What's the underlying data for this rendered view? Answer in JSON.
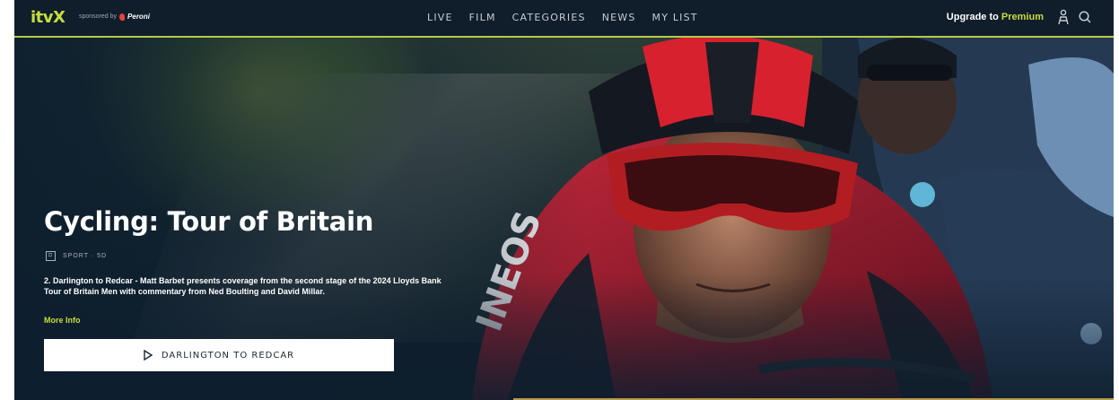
{
  "header": {
    "logo": "itvX",
    "sponsor_prefix": "sponsored by",
    "sponsor_brand": "Peroni",
    "nav": [
      "LIVE",
      "FILM",
      "CATEGORIES",
      "NEWS",
      "MY LIST"
    ],
    "upgrade_prefix": "Upgrade to",
    "upgrade_highlight": "Premium",
    "user_icon": "user-icon",
    "search_icon": "search-icon"
  },
  "hero": {
    "title": "Cycling: Tour of Britain",
    "meta": "SPORT · 5D",
    "description": "2. Darlington to Redcar - Matt Barbet presents coverage from the second stage of the 2024 Lloyds Bank Tour of Britain Men with commentary from Ned Boulting and David Millar.",
    "more_info": "More Info",
    "play_label": "DARLINGTON TO REDCAR"
  },
  "colors": {
    "accent": "#c7dd3e",
    "background": "#0d1e2e",
    "button_bg": "#ffffff"
  }
}
